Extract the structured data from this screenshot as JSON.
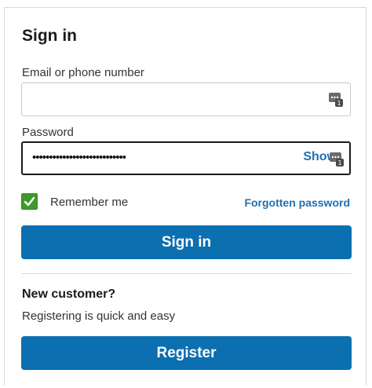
{
  "signin": {
    "title": "Sign in",
    "email_label": "Email or phone number",
    "email_value": "",
    "password_label": "Password",
    "password_value": "••••••••••••••••••••••••••••",
    "show_label": "Show",
    "remember_label": "Remember me",
    "remember_checked": true,
    "forgot_label": "Forgotten password",
    "button_label": "Sign in"
  },
  "register": {
    "heading": "New customer?",
    "subtext": "Registering is quick and easy",
    "button_label": "Register"
  },
  "colors": {
    "primary": "#0b6fb0",
    "link": "#1f6fb2",
    "checkbox": "#3e9a2b"
  },
  "icons": {
    "field_icon": "password-manager-icon",
    "check": "checkmark-icon"
  }
}
